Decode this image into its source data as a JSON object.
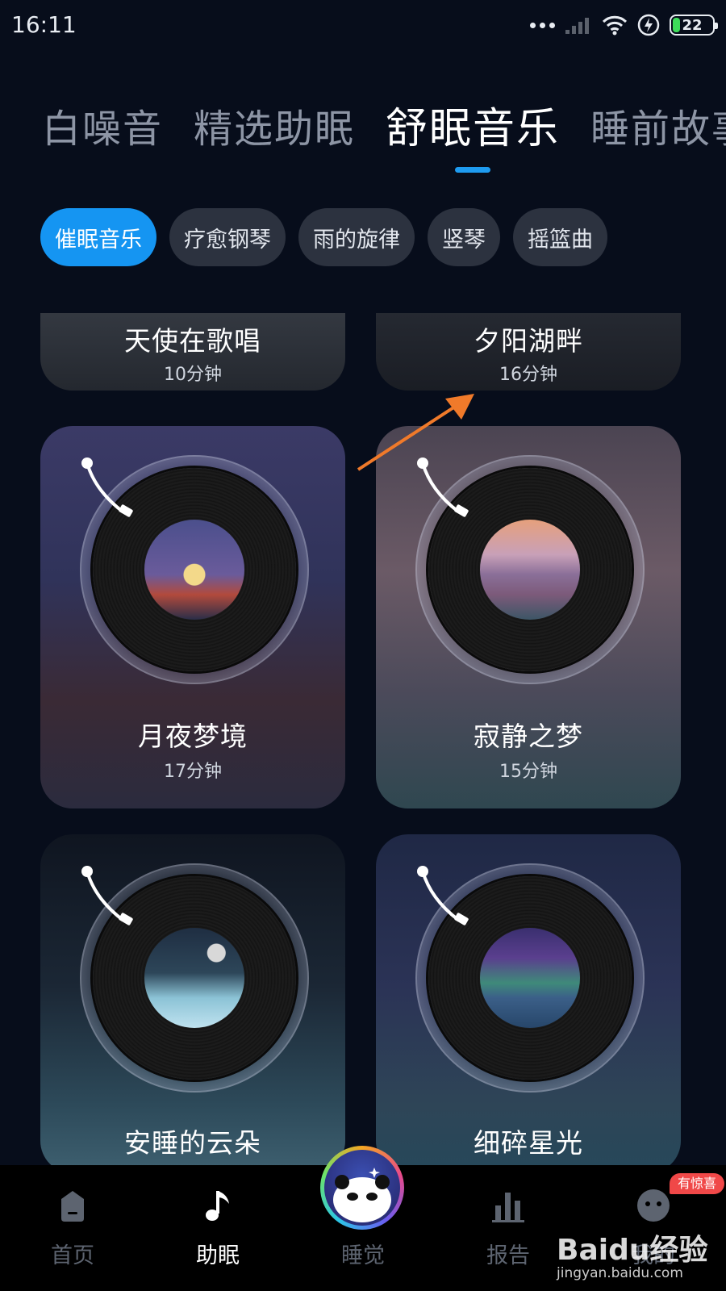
{
  "status_bar": {
    "time": "16:11",
    "battery": "22"
  },
  "tabs": [
    {
      "label": "白噪音",
      "active": false
    },
    {
      "label": "精选助眠",
      "active": false
    },
    {
      "label": "舒眠音乐",
      "active": true
    },
    {
      "label": "睡前故事",
      "active": false
    }
  ],
  "chips": [
    {
      "label": "催眠音乐",
      "active": true
    },
    {
      "label": "疗愈钢琴",
      "active": false
    },
    {
      "label": "雨的旋律",
      "active": false
    },
    {
      "label": "竖琴",
      "active": false
    },
    {
      "label": "摇篮曲",
      "active": false
    }
  ],
  "tracks": [
    {
      "title": "天使在歌唱",
      "duration": "10分钟"
    },
    {
      "title": "夕阳湖畔",
      "duration": "16分钟"
    },
    {
      "title": "月夜梦境",
      "duration": "17分钟"
    },
    {
      "title": "寂静之梦",
      "duration": "15分钟"
    },
    {
      "title": "安睡的云朵",
      "duration": ""
    },
    {
      "title": "细碎星光",
      "duration": ""
    }
  ],
  "bottom_nav": [
    {
      "label": "首页",
      "icon": "home-icon"
    },
    {
      "label": "助眠",
      "icon": "music-note-icon",
      "active": true
    },
    {
      "label": "睡觉",
      "icon": "panda-icon"
    },
    {
      "label": "报告",
      "icon": "bar-chart-icon"
    },
    {
      "label": "我的",
      "icon": "profile-icon"
    }
  ],
  "badge": "有惊喜",
  "watermark": {
    "text": "Baidu经验",
    "url": "jingyan.baidu.com"
  },
  "colors": {
    "accent": "#1595f2",
    "background": "#070d1b",
    "annotation_arrow": "#f07a2a"
  }
}
